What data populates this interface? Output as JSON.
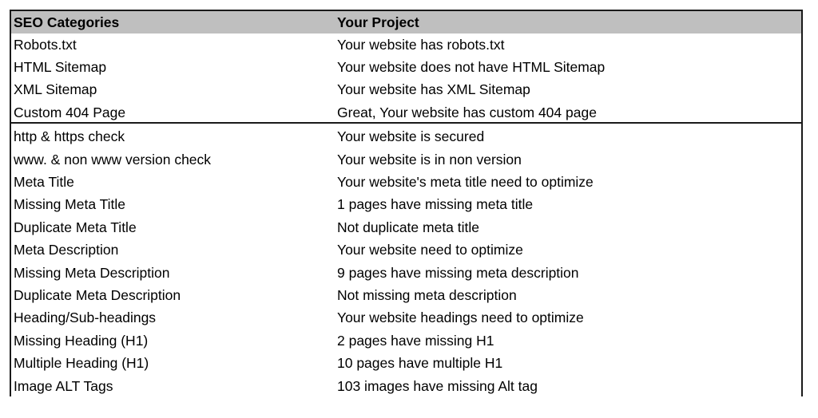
{
  "table": {
    "headers": {
      "category": "SEO Categories",
      "project": "Your Project"
    },
    "section1": [
      {
        "category": "Robots.txt",
        "project": "Your website has robots.txt"
      },
      {
        "category": "HTML Sitemap",
        "project": "Your website does not have HTML Sitemap"
      },
      {
        "category": "XML Sitemap",
        "project": "Your website has XML Sitemap"
      },
      {
        "category": "Custom 404 Page",
        "project": "Great, Your website has custom 404 page"
      }
    ],
    "section2": [
      {
        "category": "http & https check",
        "project": "Your website is  secured"
      },
      {
        "category": "www. & non www version check",
        "project": "Your website is in non version"
      },
      {
        "category": "Meta Title",
        "project": "Your website's meta title need to optimize"
      },
      {
        "category": "Missing Meta Title",
        "project": "1 pages have missing meta title"
      },
      {
        "category": "Duplicate Meta Title",
        "project": "Not duplicate meta title"
      },
      {
        "category": "Meta Description",
        "project": "Your website need to optimize"
      },
      {
        "category": "Missing Meta Description",
        "project": "9 pages have missing meta description"
      },
      {
        "category": "Duplicate Meta Description",
        "project": "Not missing meta description"
      },
      {
        "category": "Heading/Sub-headings",
        "project": "Your website headings need to optimize"
      },
      {
        "category": "Missing Heading (H1)",
        "project": "2 pages have missing H1"
      },
      {
        "category": "Multiple Heading (H1)",
        "project": "10 pages have multiple H1"
      },
      {
        "category": "Image ALT Tags",
        "project": "103 images have missing Alt tag"
      }
    ]
  },
  "colors": {
    "header_bg": "#bfbfbf",
    "border": "#1a1a1a",
    "text": "#000000"
  }
}
